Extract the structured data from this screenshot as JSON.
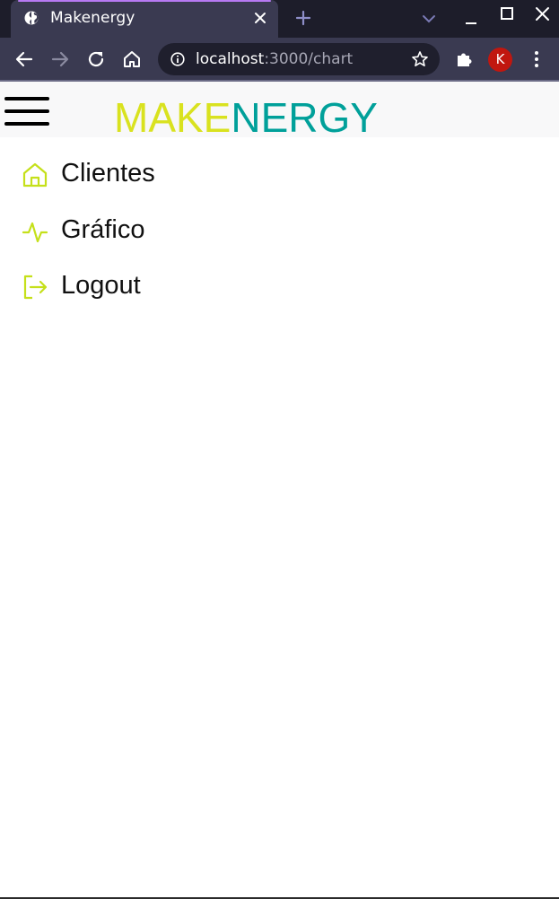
{
  "browser": {
    "tab_title": "Makenergy",
    "url_host": "localhost",
    "url_rest": ":3000/chart",
    "profile_initial": "K",
    "colors": {
      "tabstrip": "#1d1d2a",
      "toolbar": "#3a3a51",
      "accent": "#b679f2",
      "avatar": "#c1170f"
    },
    "icons": [
      "globe-icon",
      "close-icon",
      "plus-icon",
      "chevron-down-icon",
      "minimize-icon",
      "maximize-icon",
      "window-close-icon",
      "back-arrow-icon",
      "forward-arrow-icon",
      "reload-icon",
      "home-icon",
      "info-icon",
      "star-icon",
      "extensions-icon",
      "kebab-menu-icon"
    ]
  },
  "header": {
    "logo_part1": "MAKE",
    "logo_part2": "NERGY",
    "logo_colors": {
      "primary": "#d9e21f",
      "secondary": "#00a09a"
    },
    "menu_icon": "hamburger-icon"
  },
  "nav": {
    "icon_color": "#c5e01a",
    "items": [
      {
        "label": "Clientes",
        "icon": "home-icon"
      },
      {
        "label": "Gráfico",
        "icon": "activity-icon"
      },
      {
        "label": "Logout",
        "icon": "logout-icon"
      }
    ]
  }
}
